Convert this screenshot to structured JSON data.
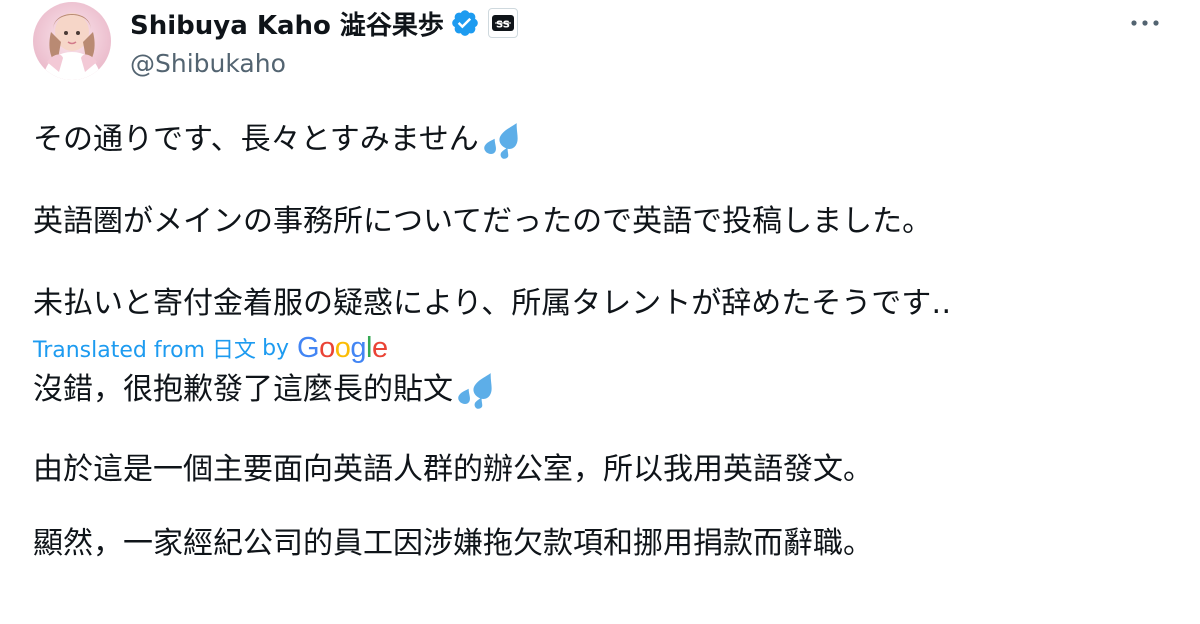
{
  "author": {
    "display_name": "Shibuya Kaho 澁谷果歩",
    "handle": "@Shibukaho",
    "verified": true,
    "affiliate_badge_icon": "affiliate-badge-icon",
    "avatar_colors": [
      "#f3c9d6",
      "#fbe7ee"
    ]
  },
  "menu": {
    "icon": "more-dots-icon"
  },
  "original": {
    "paragraphs": [
      "その通りです、長々とすみません",
      "英語圏がメインの事務所についてだったので英語で投稿しました。",
      "未払いと寄付金着服の疑惑により、所属タレントが辞めたそうです‥"
    ]
  },
  "translation_bar": {
    "prefix": "Translated from",
    "language": "日文",
    "by": "by",
    "provider": {
      "letters": [
        "G",
        "o",
        "o",
        "g",
        "l",
        "e"
      ],
      "colors": [
        "#4285f4",
        "#ea4335",
        "#fbbc05",
        "#4285f4",
        "#34a853",
        "#ea4335"
      ]
    }
  },
  "translated": {
    "paragraphs": [
      "沒錯，很抱歉發了這麼長的貼文",
      "由於這是一個主要面向英語人群的辦公室，所以我用英語發文。",
      "顯然，一家經紀公司的員工因涉嫌拖欠款項和挪用捐款而辭職。"
    ]
  },
  "colors": {
    "link": "#1d9bf0",
    "secondary_text": "#536471",
    "verified_badge": "#1d9bf0",
    "sweat_drops": "#5daee8"
  }
}
